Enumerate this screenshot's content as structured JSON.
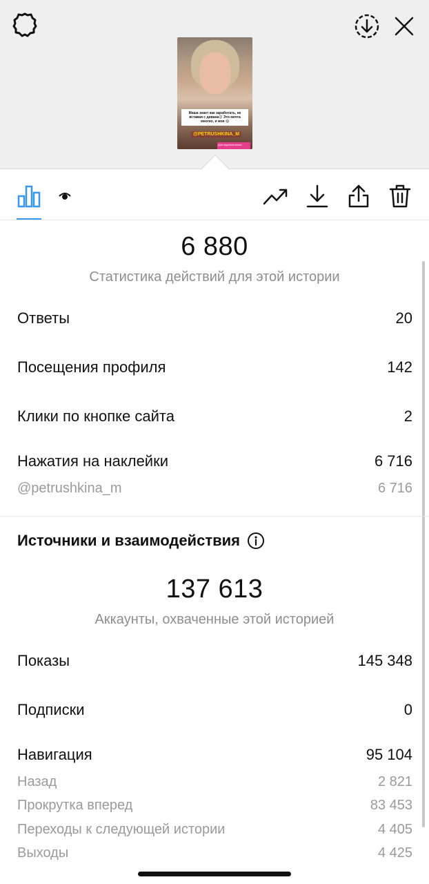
{
  "story": {
    "caption": "Маша знает как заработать, не вставая с дивана😉 Это мечта многих, и моя 😋",
    "sticker": "@PETRUSHKINA_M",
    "banner": "Для вдохновления"
  },
  "toolbar": {
    "icons": [
      "bar-chart-icon",
      "eye-icon",
      "trending-icon",
      "download-icon",
      "share-icon",
      "trash-icon"
    ],
    "accent": "#3897f0"
  },
  "actions": {
    "total": "6 880",
    "caption": "Статистика действий для этой истории",
    "rows": [
      {
        "label": "Ответы",
        "value": "20"
      },
      {
        "label": "Посещения профиля",
        "value": "142"
      },
      {
        "label": "Клики по кнопке сайта",
        "value": "2"
      },
      {
        "label": "Нажатия на наклейки",
        "value": "6 716"
      }
    ],
    "sticker_row": {
      "label": "@petrushkina_m",
      "value": "6 716"
    }
  },
  "discovery": {
    "title": "Источники и взаимодействия",
    "reach": "137 613",
    "caption": "Аккаунты, охваченные этой историей",
    "rows": [
      {
        "label": "Показы",
        "value": "145 348"
      },
      {
        "label": "Подписки",
        "value": "0"
      },
      {
        "label": "Навигация",
        "value": "95 104"
      }
    ],
    "navigation": [
      {
        "label": "Назад",
        "value": "2 821"
      },
      {
        "label": "Прокрутка вперед",
        "value": "83 453"
      },
      {
        "label": "Переходы к следующей истории",
        "value": "4 405"
      },
      {
        "label": "Выходы",
        "value": "4 425"
      }
    ]
  }
}
